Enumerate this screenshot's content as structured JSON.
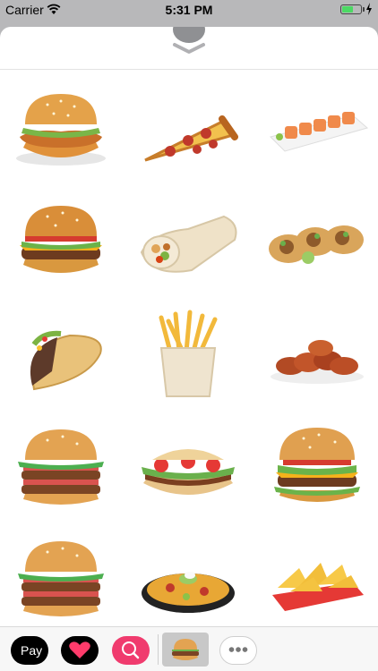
{
  "status_bar": {
    "carrier": "Carrier",
    "time": "5:31 PM",
    "battery_level": 0.6,
    "battery_color": "#4cd964"
  },
  "sheet": {
    "handle_icon": "chevron-down-icon"
  },
  "stickers": [
    {
      "name": "crispy-chicken-burger"
    },
    {
      "name": "pepperoni-pizza-slice"
    },
    {
      "name": "sushi-rolls"
    },
    {
      "name": "cheeseburger"
    },
    {
      "name": "burrito-wrap"
    },
    {
      "name": "street-tacos"
    },
    {
      "name": "hard-shell-taco"
    },
    {
      "name": "french-fries"
    },
    {
      "name": "chicken-wings"
    },
    {
      "name": "double-bacon-burger"
    },
    {
      "name": "loaded-flatbread-sandwich"
    },
    {
      "name": "deluxe-burger"
    },
    {
      "name": "double-bacon-burger-2"
    },
    {
      "name": "nachos-plate"
    },
    {
      "name": "nachos-tray"
    }
  ],
  "app_drawer": {
    "apps": [
      {
        "name": "apple-pay",
        "label": "Pay"
      },
      {
        "name": "digital-touch",
        "icon": "heart-icon"
      },
      {
        "name": "image-search",
        "icon": "globe-search-icon"
      },
      {
        "name": "food-stickers",
        "icon": "burger-icon",
        "selected": true
      },
      {
        "name": "more",
        "icon": "ellipsis-icon"
      }
    ]
  }
}
